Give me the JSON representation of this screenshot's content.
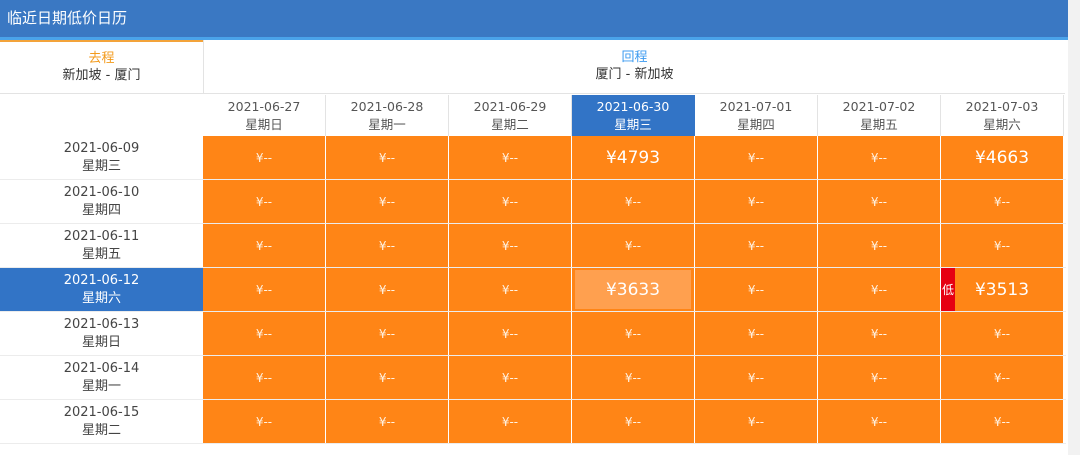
{
  "window": {
    "title": "临近日期低价日历"
  },
  "outbound": {
    "label": "去程",
    "route": "新加坡 - 厦门"
  },
  "return": {
    "label": "回程",
    "route": "厦门 - 新加坡"
  },
  "columns": [
    {
      "date": "2021-06-27",
      "weekday": "星期日"
    },
    {
      "date": "2021-06-28",
      "weekday": "星期一"
    },
    {
      "date": "2021-06-29",
      "weekday": "星期二"
    },
    {
      "date": "2021-06-30",
      "weekday": "星期三"
    },
    {
      "date": "2021-07-01",
      "weekday": "星期四"
    },
    {
      "date": "2021-07-02",
      "weekday": "星期五"
    },
    {
      "date": "2021-07-03",
      "weekday": "星期六"
    }
  ],
  "selected_column": 3,
  "selected_row": 3,
  "rows": [
    {
      "date": "2021-06-09",
      "weekday": "星期三",
      "prices": [
        "¥--",
        "¥--",
        "¥--",
        "¥4793",
        "¥--",
        "¥--",
        "¥4663"
      ]
    },
    {
      "date": "2021-06-10",
      "weekday": "星期四",
      "prices": [
        "¥--",
        "¥--",
        "¥--",
        "¥--",
        "¥--",
        "¥--",
        "¥--"
      ]
    },
    {
      "date": "2021-06-11",
      "weekday": "星期五",
      "prices": [
        "¥--",
        "¥--",
        "¥--",
        "¥--",
        "¥--",
        "¥--",
        "¥--"
      ]
    },
    {
      "date": "2021-06-12",
      "weekday": "星期六",
      "prices": [
        "¥--",
        "¥--",
        "¥--",
        "¥3633",
        "¥--",
        "¥--",
        "¥3513"
      ]
    },
    {
      "date": "2021-06-13",
      "weekday": "星期日",
      "prices": [
        "¥--",
        "¥--",
        "¥--",
        "¥--",
        "¥--",
        "¥--",
        "¥--"
      ]
    },
    {
      "date": "2021-06-14",
      "weekday": "星期一",
      "prices": [
        "¥--",
        "¥--",
        "¥--",
        "¥--",
        "¥--",
        "¥--",
        "¥--"
      ]
    },
    {
      "date": "2021-06-15",
      "weekday": "星期二",
      "prices": [
        "¥--",
        "¥--",
        "¥--",
        "¥--",
        "¥--",
        "¥--",
        "¥--"
      ]
    }
  ],
  "lowest_badge": {
    "label": "低",
    "row": 3,
    "col": 6
  },
  "colors": {
    "accent": "#3274c6",
    "cell": "#ff8516",
    "selected_cell": "#ffa04f",
    "low": "#e60012",
    "outbound": "#f39a1b",
    "return": "#3d9bf0"
  }
}
